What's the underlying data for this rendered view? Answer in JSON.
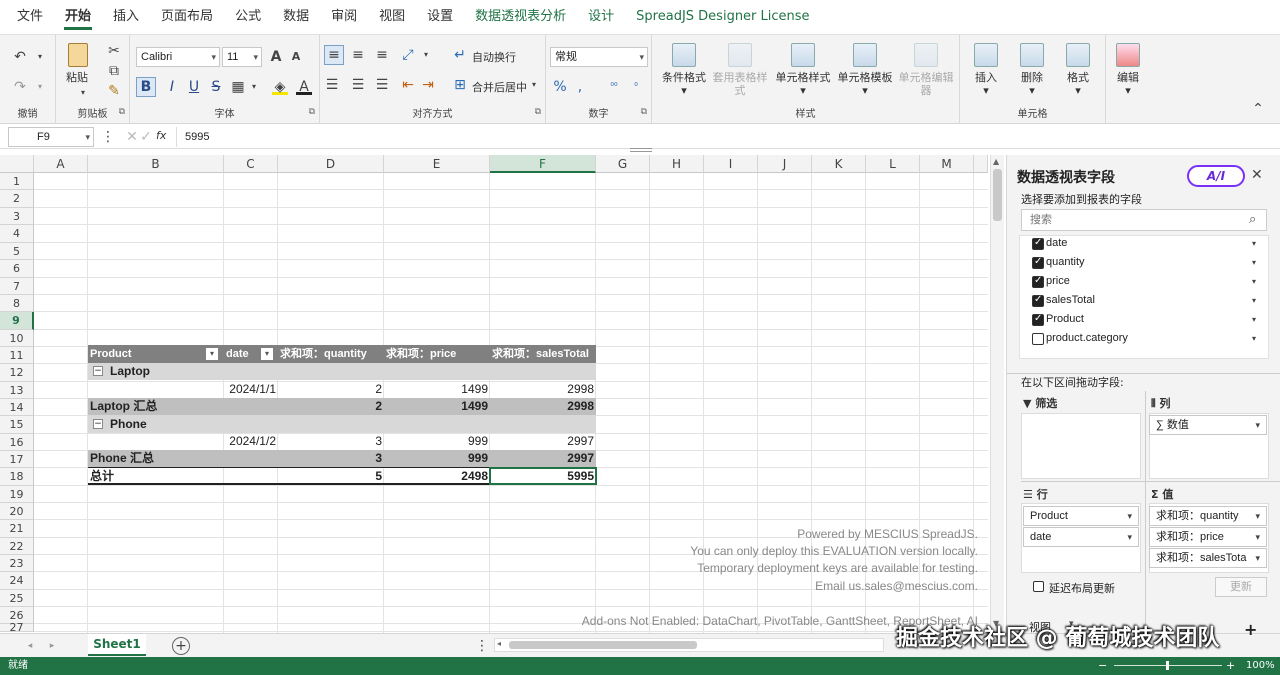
{
  "menu": {
    "tabs": [
      "文件",
      "开始",
      "插入",
      "页面布局",
      "公式",
      "数据",
      "审阅",
      "视图",
      "设置",
      "数据透视表分析",
      "设计",
      "SpreadJS Designer License"
    ]
  },
  "ribbon": {
    "undo_group": "撤销",
    "clipboard": {
      "label": "剪贴板",
      "paste": "粘贴"
    },
    "font": {
      "label": "字体",
      "family": "Calibri",
      "size": "11"
    },
    "align": {
      "label": "对齐方式",
      "wrap": "自动换行",
      "merge": "合并后居中"
    },
    "number": {
      "label": "数字",
      "format": "常规"
    },
    "style": {
      "label": "样式",
      "cond": "条件格式",
      "table_style": "套用表格样式",
      "cell_style": "单元格样式",
      "cell_template": "单元格模板",
      "cell_edit": "单元格编辑器"
    },
    "cells": {
      "label": "单元格",
      "insert": "插入",
      "delete": "删除",
      "format": "格式",
      "edit": "编辑"
    }
  },
  "formula_bar": {
    "name_box": "F9",
    "fx": "fx",
    "value": "5995"
  },
  "grid": {
    "columns": [
      "A",
      "B",
      "C",
      "D",
      "E",
      "F",
      "G",
      "H",
      "I",
      "J",
      "K",
      "L",
      "M"
    ],
    "rows": [
      "1",
      "2",
      "3",
      "4",
      "5",
      "6",
      "7",
      "8",
      "9",
      "10",
      "11",
      "12",
      "13",
      "14",
      "15",
      "16",
      "17",
      "18",
      "19",
      "20",
      "21",
      "22",
      "23",
      "24",
      "25",
      "26",
      "27"
    ],
    "selected_col": "F",
    "selected_row": "9",
    "pivot": {
      "h_product": "Product",
      "h_date": "date",
      "h_qty": "求和项：quantity",
      "h_price": "求和项：price",
      "h_total": "求和项：salesTotal",
      "laptop": "Laptop",
      "laptop_date": "2024/1/1",
      "laptop_qty": "2",
      "laptop_price": "1499",
      "laptop_total": "2998",
      "laptop_sum": "Laptop 汇总",
      "laptop_sum_qty": "2",
      "laptop_sum_price": "1499",
      "laptop_sum_total": "2998",
      "phone": "Phone",
      "phone_date": "2024/1/2",
      "phone_qty": "3",
      "phone_price": "999",
      "phone_total": "2997",
      "phone_sum": "Phone 汇总",
      "phone_sum_qty": "3",
      "phone_sum_price": "999",
      "phone_sum_total": "2997",
      "grand": "总计",
      "grand_qty": "5",
      "grand_price": "2498",
      "grand_total": "5995"
    },
    "watermark": [
      "Powered by MESCIUS SpreadJS.",
      "You can only deploy this EVALUATION version locally.",
      "Temporary deployment keys are available for testing.",
      "Email us.sales@mescius.com.",
      "Add-ons Not Enabled: DataChart, PivotTable, GanttSheet, ReportSheet, AI"
    ]
  },
  "pane": {
    "title": "数据透视表字段",
    "ai": "A/I",
    "subtitle": "选择要添加到报表的字段",
    "search_placeholder": "搜索",
    "fields": [
      {
        "name": "date",
        "checked": true
      },
      {
        "name": "quantity",
        "checked": true
      },
      {
        "name": "price",
        "checked": true
      },
      {
        "name": "salesTotal",
        "checked": true
      },
      {
        "name": "Product",
        "checked": true
      },
      {
        "name": "product.category",
        "checked": false
      }
    ],
    "drag_label": "在以下区间拖动字段:",
    "filter": "筛选",
    "columns": "列",
    "rows": "行",
    "values": "值",
    "col_items": [
      "∑ 数值"
    ],
    "row_items": [
      "Product",
      "date"
    ],
    "value_items": [
      "求和项：quantity",
      "求和项：price",
      "求和项：salesTota"
    ],
    "defer": "延迟布局更新",
    "update": "更新",
    "view": "视图"
  },
  "sheet_tab": "Sheet1",
  "overlay": "掘金技术社区 @ 葡萄城技术团队",
  "status": {
    "text": "就绪",
    "zoom": "100%"
  }
}
